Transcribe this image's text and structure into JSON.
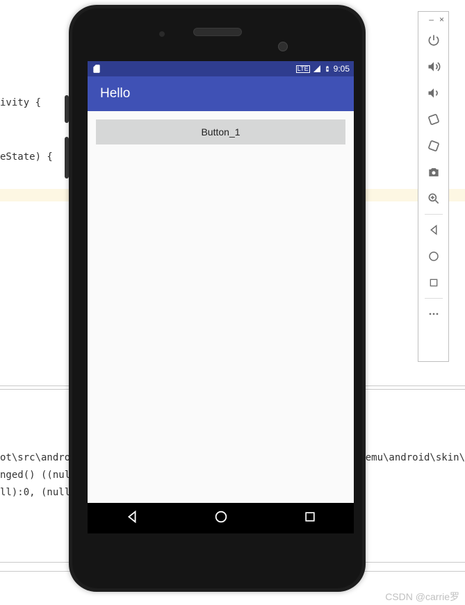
{
  "background_code": {
    "line1": "ivity {",
    "line2": "eState) {",
    "line3": "ot\\src\\androi",
    "line3b": "-emu\\android\\skin\\",
    "line4": "nged() ((nul",
    "line5": "ll):0, (null)"
  },
  "device": {
    "status_bar": {
      "signal_label": "LTE",
      "time": "9:05"
    },
    "app_bar": {
      "title": "Hello"
    },
    "content": {
      "button1_label": "Button_1"
    }
  },
  "emulator_toolbar": {
    "minimize": "–",
    "close": "×",
    "icons": [
      "power",
      "volume-up",
      "volume-down",
      "rotate-left",
      "rotate-right",
      "camera",
      "zoom",
      "back",
      "home",
      "overview",
      "more"
    ]
  },
  "watermark": "CSDN @carrie罗"
}
